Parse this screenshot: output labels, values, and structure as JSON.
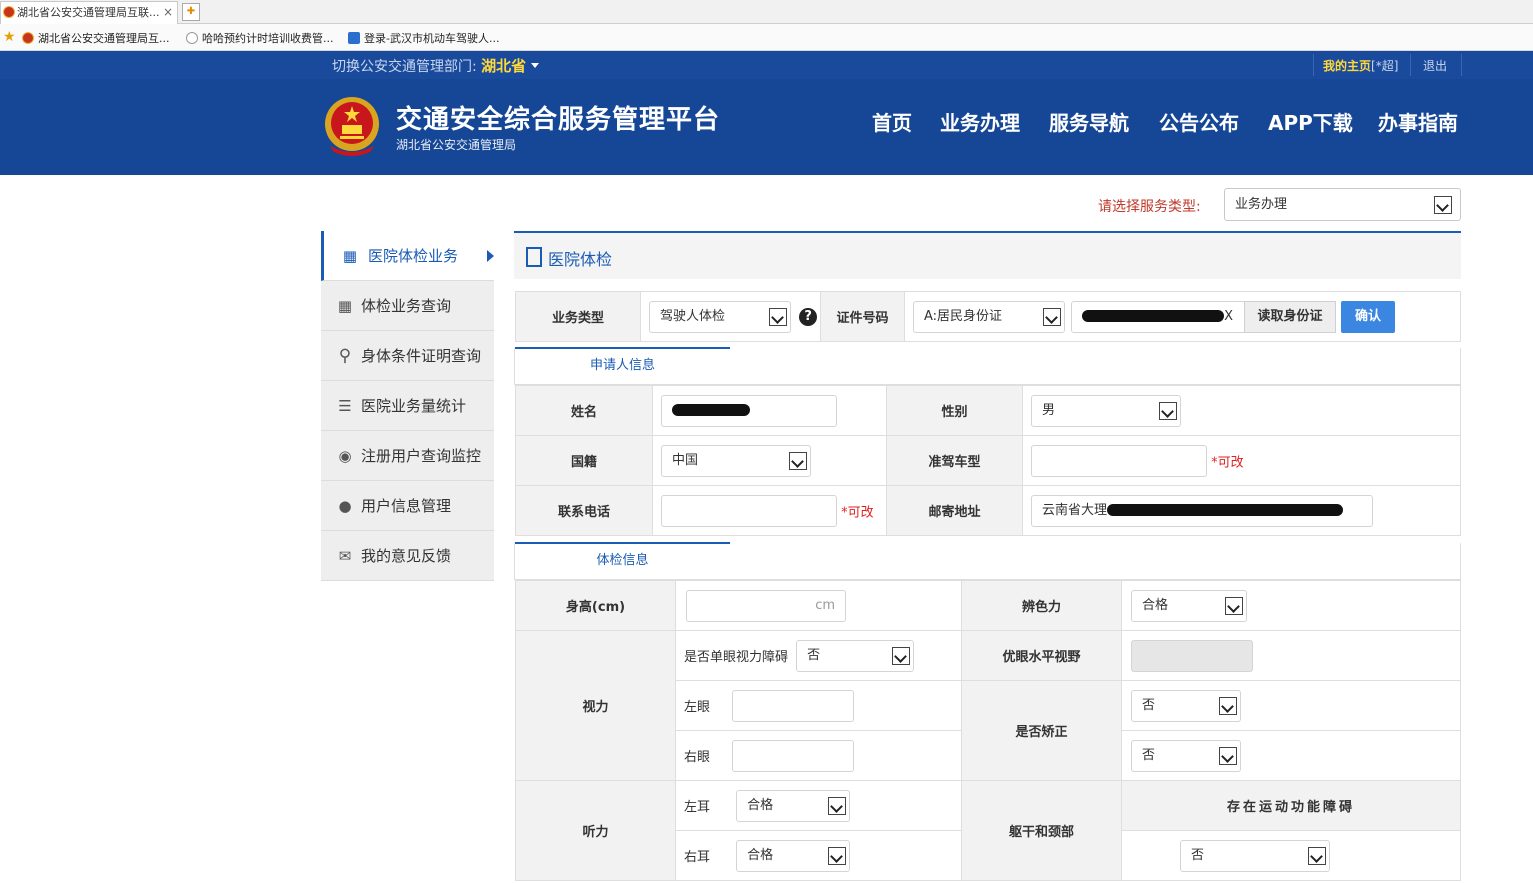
{
  "browser": {
    "tab_title": "湖北省公安交通管理局互联...",
    "tab_close": "×",
    "favorites": [
      "湖北省公安交通管理局互...",
      "哈哈预约计时培训收费管...",
      "登录-武汉市机动车驾驶人..."
    ]
  },
  "topbar": {
    "switch_label": "切换公安交通管理部门:",
    "province": "湖北省",
    "my_home": "我的主页",
    "user": "[*超]",
    "logout": "退出"
  },
  "header": {
    "title": "交通安全综合服务管理平台",
    "subtitle": "湖北省公安交通管理局",
    "nav": [
      "首页",
      "业务办理",
      "服务导航",
      "公告公布",
      "APP下载",
      "办事指南"
    ]
  },
  "service_type": {
    "label": "请选择服务类型:",
    "value": "业务办理"
  },
  "sidebar": {
    "items": [
      {
        "label": "医院体检业务",
        "icon": "building-icon"
      },
      {
        "label": "体检业务查询",
        "icon": "building-icon"
      },
      {
        "label": "身体条件证明查询",
        "icon": "search-icon"
      },
      {
        "label": "医院业务量统计",
        "icon": "list-icon"
      },
      {
        "label": "注册用户查询监控",
        "icon": "eye-icon"
      },
      {
        "label": "用户信息管理",
        "icon": "user-icon"
      },
      {
        "label": "我的意见反馈",
        "icon": "feedback-icon"
      }
    ]
  },
  "panel": {
    "title": "医院体检"
  },
  "query": {
    "business_type_label": "业务类型",
    "business_type_value": "驾驶人体检",
    "id_label": "证件号码",
    "id_type_value": "A:居民身份证",
    "id_number_visible": "X",
    "read_id_button": "读取身份证",
    "confirm_button": "确认"
  },
  "applicant": {
    "section_label": "申请人信息",
    "name_label": "姓名",
    "gender_label": "性别",
    "gender_value": "男",
    "nationality_label": "国籍",
    "nationality_value": "中国",
    "vehicle_class_label": "准驾车型",
    "editable_mark": "*可改",
    "phone_label": "联系电话",
    "address_label": "邮寄地址",
    "address_value": "云南省大理"
  },
  "exam": {
    "section_label": "体检信息",
    "height_label": "身高(cm)",
    "height_unit": "cm",
    "color_vision_label": "辨色力",
    "color_vision_value": "合格",
    "vision_label": "视力",
    "mono_impair_label": "是否单眼视力障碍",
    "mono_impair_value": "否",
    "better_eye_label": "优眼水平视野",
    "left_eye_label": "左眼",
    "right_eye_label": "右眼",
    "corrected_label": "是否矫正",
    "corrected_left_value": "否",
    "corrected_right_value": "否",
    "hearing_label": "听力",
    "left_ear_label": "左耳",
    "left_ear_value": "合格",
    "right_ear_label": "右耳",
    "right_ear_value": "合格",
    "trunk_label": "躯干和颈部",
    "motor_label": "存在运动功能障碍",
    "motor_value": "否"
  },
  "colors": {
    "header_blue": "#164797",
    "accent_blue": "#1a5bb5",
    "confirm_blue": "#3a86e0",
    "highlight_yellow": "#ffd83a",
    "editable_red": "#e02020"
  }
}
